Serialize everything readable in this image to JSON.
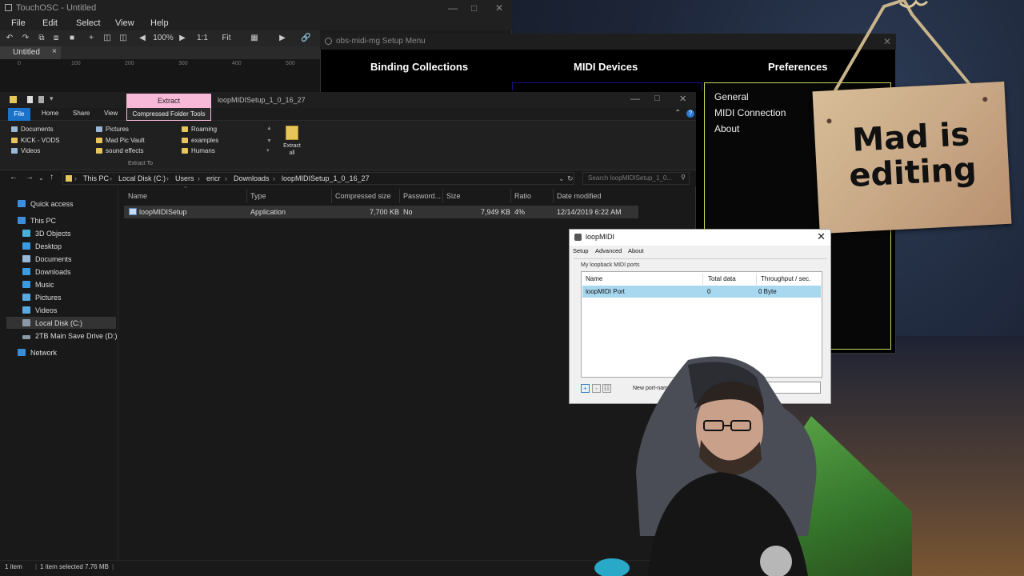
{
  "touchosc": {
    "title": "TouchOSC - Untitled",
    "menu": [
      "File",
      "Edit",
      "Select",
      "View",
      "Help"
    ],
    "zoom": "100%",
    "ratio": "1:1",
    "fit": "Fit",
    "tab": "Untitled",
    "ruler": [
      "0",
      "100",
      "200",
      "300",
      "400",
      "500"
    ]
  },
  "obs_setup": {
    "title": "obs-midi-mg Setup Menu",
    "tabs": [
      "Binding Collections",
      "MIDI Devices",
      "Preferences"
    ],
    "preferences_items": [
      "General",
      "MIDI Connection",
      "About"
    ]
  },
  "explorer": {
    "context_tab": "Extract",
    "window_title": "loopMIDISetup_1_0_16_27",
    "ribbon_tabs": [
      "File",
      "Home",
      "Share",
      "View",
      "Compressed Folder Tools"
    ],
    "quick_items": [
      [
        "Documents",
        "Pictures",
        "Roaming"
      ],
      [
        "KICK - VODS",
        "Mad Pic Vault",
        "examples"
      ],
      [
        "Videos",
        "sound effects",
        "Humans"
      ]
    ],
    "extract_all_line1": "Extract",
    "extract_all_line2": "all",
    "extract_to": "Extract To",
    "breadcrumb": [
      "This PC",
      "Local Disk (C:)",
      "Users",
      "ericr",
      "Downloads",
      "loopMIDISetup_1_0_16_27"
    ],
    "search_placeholder": "Search loopMIDISetup_1_0...",
    "nav": [
      "Quick access",
      "This PC",
      "3D Objects",
      "Desktop",
      "Documents",
      "Downloads",
      "Music",
      "Pictures",
      "Videos",
      "Local Disk (C:)",
      "2TB Main Save Drive (D:)",
      "Network"
    ],
    "columns": [
      "Name",
      "Type",
      "Compressed size",
      "Password...",
      "Size",
      "Ratio",
      "Date modified"
    ],
    "file": {
      "name": "loopMIDISetup",
      "type": "Application",
      "compressed": "7,700 KB",
      "password": "No",
      "size": "7,949 KB",
      "ratio": "4%",
      "modified": "12/14/2019 6:22 AM"
    },
    "status_items": "1 item",
    "status_selected": "1 item selected  7.76 MB"
  },
  "loopmidi": {
    "title": "loopMIDI",
    "tabs": [
      "Setup",
      "Advanced",
      "About"
    ],
    "group": "My loopback MIDI ports",
    "columns": [
      "Name",
      "Total data",
      "Throughput / sec."
    ],
    "row": {
      "name": "loopMIDI Port",
      "total": "0",
      "throughput": "0 Byte"
    },
    "new_port_label": "New port-name:",
    "new_port_value": "loop"
  },
  "sign": {
    "line1": "Mad is",
    "line2": "editing"
  }
}
